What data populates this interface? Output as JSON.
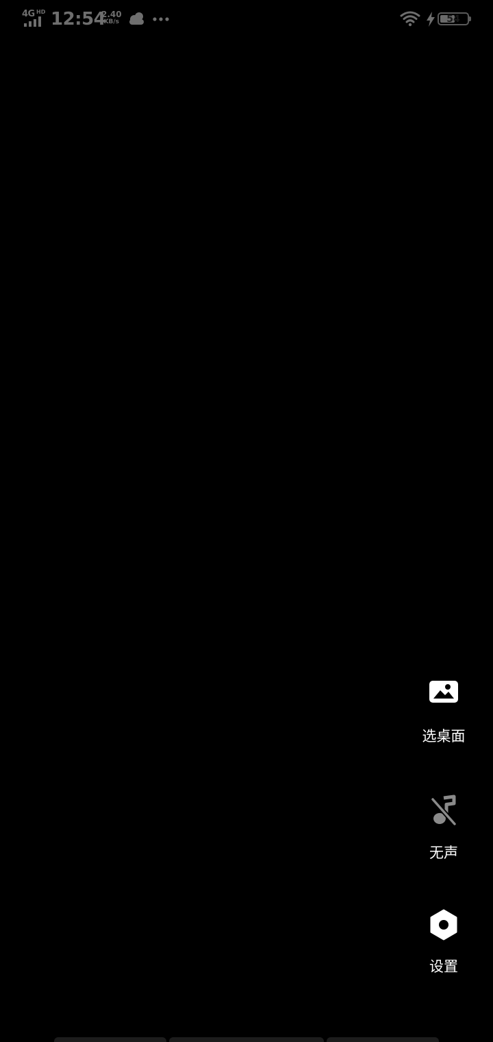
{
  "status_bar": {
    "network_type": "4G",
    "network_hd": "HD",
    "time": "12:54",
    "speed_value": "2.40",
    "speed_unit": "KB/s",
    "battery_level": "54",
    "battery_fraction": 0.54,
    "icons": [
      "signal-icon",
      "cloud-icon",
      "more-icon",
      "wifi-icon",
      "charging-icon",
      "battery-icon"
    ]
  },
  "actions": {
    "wallpaper": {
      "label": "选桌面",
      "icon": "image-icon"
    },
    "sound": {
      "label": "无声",
      "icon": "music-off-icon"
    },
    "settings": {
      "label": "设置",
      "icon": "settings-icon"
    }
  },
  "colors": {
    "background": "#000000",
    "status_text": "#6e6e6e",
    "label_text": "#ffffff",
    "icon_white": "#ffffff",
    "icon_muted": "#8a8a8a"
  }
}
